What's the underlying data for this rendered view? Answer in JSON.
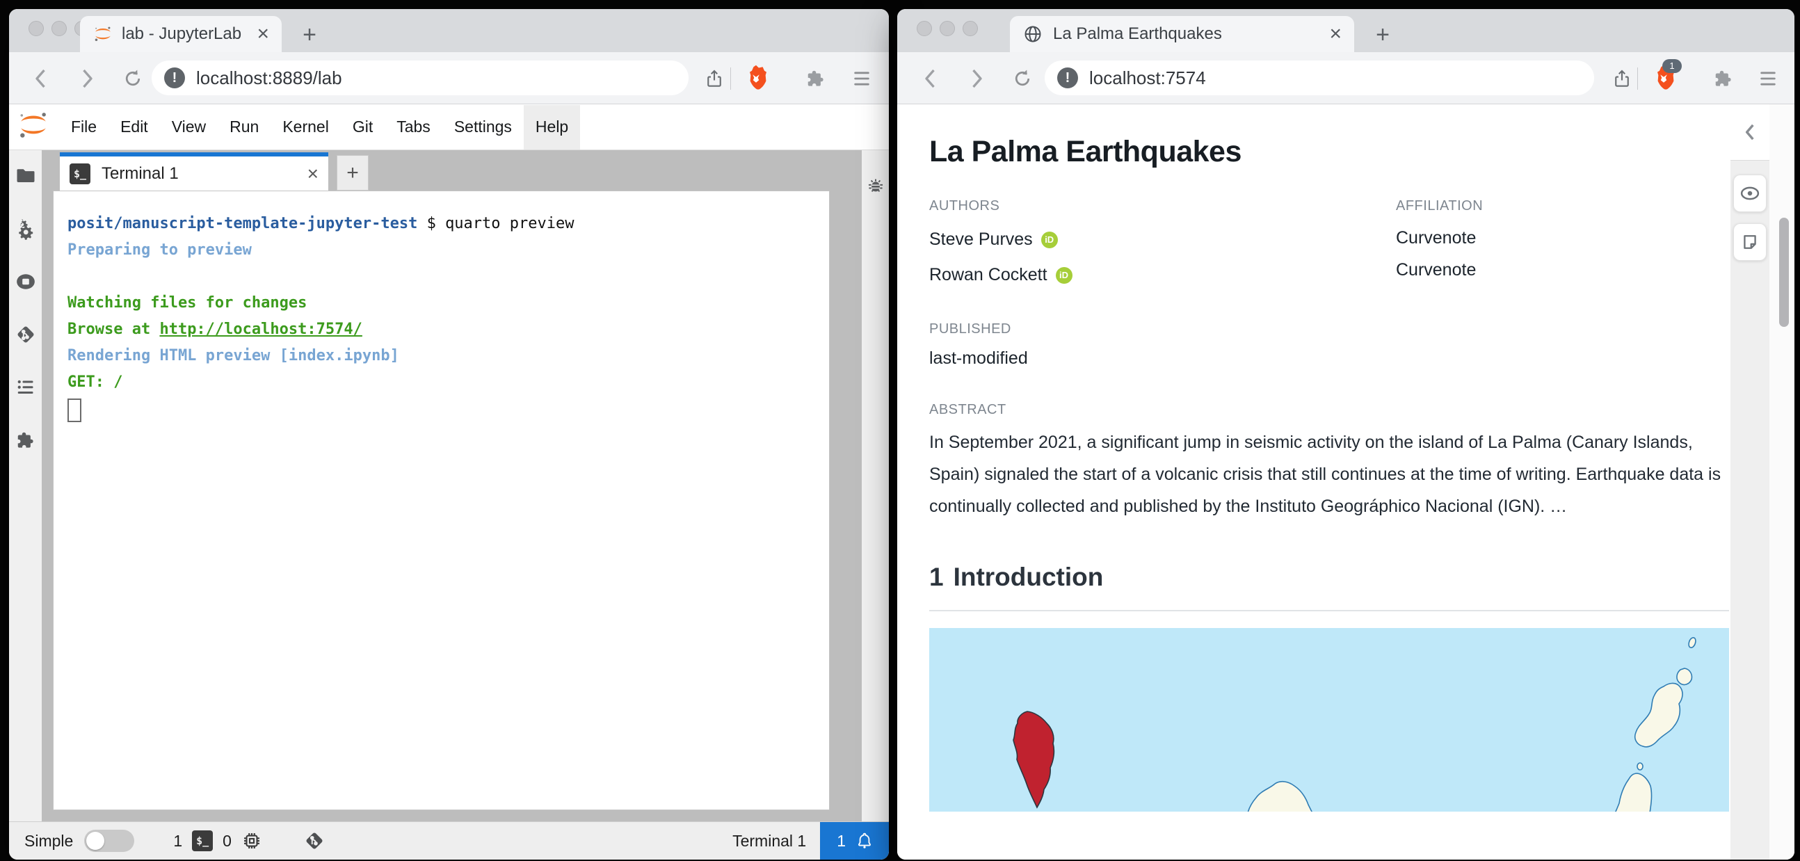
{
  "colors": {
    "accent_blue": "#1976d2",
    "term_path": "#2a5d9f",
    "term_info": "#78a5d3",
    "term_ok": "#3c9b1d",
    "orcid_green": "#a6ce39",
    "brave_orange": "#f4501e",
    "map_ocean": "#bfe8f9",
    "map_land": "#f9f8e8",
    "map_outline": "#2f7cb3",
    "map_highlight": "#c0222f"
  },
  "left_window": {
    "browser_tab_title": "lab - JupyterLab",
    "url": "localhost:8889/lab",
    "close_tab_glyph": "×",
    "new_tab_glyph": "+",
    "site_badge_glyph": "!",
    "menu": [
      "File",
      "Edit",
      "View",
      "Run",
      "Kernel",
      "Git",
      "Tabs",
      "Settings",
      "Help"
    ],
    "dock": {
      "tab_title": "Terminal 1",
      "terminal_icon_text": "$_",
      "close_glyph": "×",
      "new_glyph": "+"
    },
    "terminal": {
      "lines": [
        {
          "segments": [
            {
              "text": "posit/manuscript-template-jupyter-test",
              "style": "path"
            },
            {
              "text": " $ quarto preview",
              "style": "plain"
            }
          ]
        },
        {
          "segments": [
            {
              "text": "Preparing to preview",
              "style": "info"
            }
          ]
        },
        {
          "segments": []
        },
        {
          "segments": [
            {
              "text": "Watching files for changes",
              "style": "ok"
            }
          ]
        },
        {
          "segments": [
            {
              "text": "Browse at ",
              "style": "ok"
            },
            {
              "text": "http://localhost:7574/",
              "style": "link"
            }
          ]
        },
        {
          "segments": [
            {
              "text": "Rendering HTML preview [index.ipynb]",
              "style": "info"
            }
          ]
        },
        {
          "segments": [
            {
              "text": "GET: /",
              "style": "ok"
            }
          ]
        }
      ]
    },
    "status_bar": {
      "mode_label": "Simple",
      "terminals_count": "1",
      "terminal_icon_text": "$_",
      "kernels_count": "0",
      "active_item": "Terminal 1",
      "notification_count": "1"
    }
  },
  "right_window": {
    "browser_tab_title": "La Palma Earthquakes",
    "url": "localhost:7574",
    "close_tab_glyph": "×",
    "new_tab_glyph": "+",
    "site_badge_glyph": "!",
    "shield_badge": "1",
    "article": {
      "title": "La Palma Earthquakes",
      "authors_label": "AUTHORS",
      "affiliation_label": "AFFILIATION",
      "authors": [
        {
          "name": "Steve Purves",
          "orcid": "iD",
          "affiliation": "Curvenote"
        },
        {
          "name": "Rowan Cockett",
          "orcid": "iD",
          "affiliation": "Curvenote"
        }
      ],
      "published_label": "PUBLISHED",
      "published_value": "last-modified",
      "abstract_label": "ABSTRACT",
      "abstract_text": "In September 2021, a significant jump in seismic activity on the island of La Palma (Canary Islands, Spain) signaled the start of a volcanic crisis that still continues at the time of writing. Earthquake data is continually collected and published by the Instituto Geográphico Nacional (IGN). …",
      "section_number": "1",
      "section_title": "Introduction"
    }
  }
}
